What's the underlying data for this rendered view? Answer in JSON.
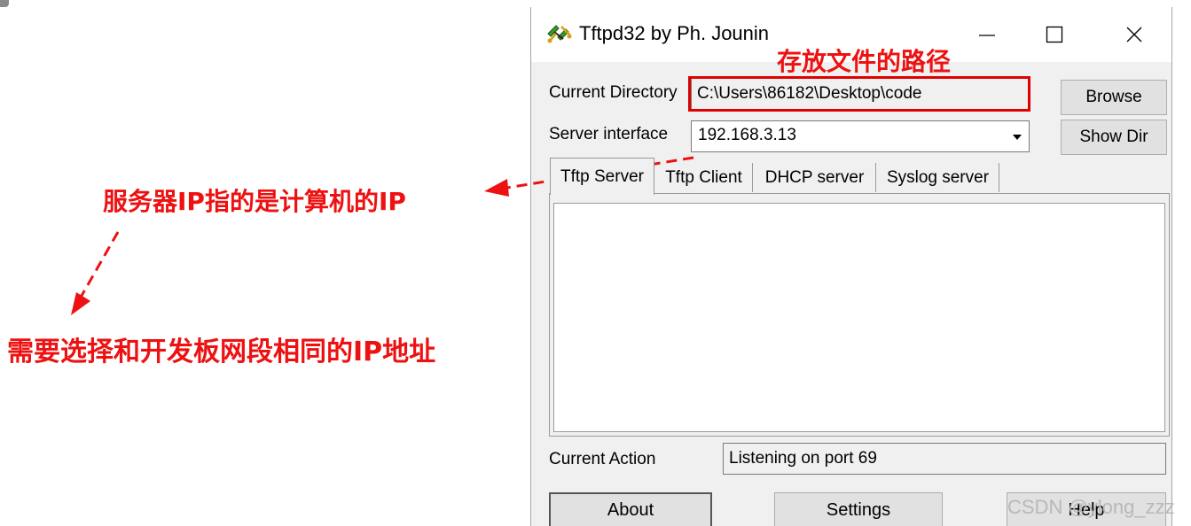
{
  "window": {
    "title": "Tftpd32 by Ph. Jounin",
    "minimize_symbol": "—",
    "close_symbol": "✕",
    "app_icon": "network-cables-icon"
  },
  "directory": {
    "label": "Current Directory",
    "value": "C:\\Users\\86182\\Desktop\\code",
    "browse_label": "Browse"
  },
  "server": {
    "label": "Server interface",
    "value": "192.168.3.13",
    "show_dir_label": "Show Dir"
  },
  "tabs": [
    {
      "label": "Tftp Server",
      "active": true
    },
    {
      "label": "Tftp Client",
      "active": false
    },
    {
      "label": "DHCP server",
      "active": false
    },
    {
      "label": "Syslog server",
      "active": false
    }
  ],
  "status": {
    "label": "Current Action",
    "value": "Listening on port 69"
  },
  "bottom_buttons": {
    "about": "About",
    "settings": "Settings",
    "help": "Help"
  },
  "annotations": {
    "path_note": "存放文件的路径",
    "server_ip_note": "服务器IP指的是计算机的IP",
    "network_note": "需要选择和开发板网段相同的IP地址",
    "color": "#ee1111"
  },
  "watermark": "CSDN @ylong_zzz"
}
